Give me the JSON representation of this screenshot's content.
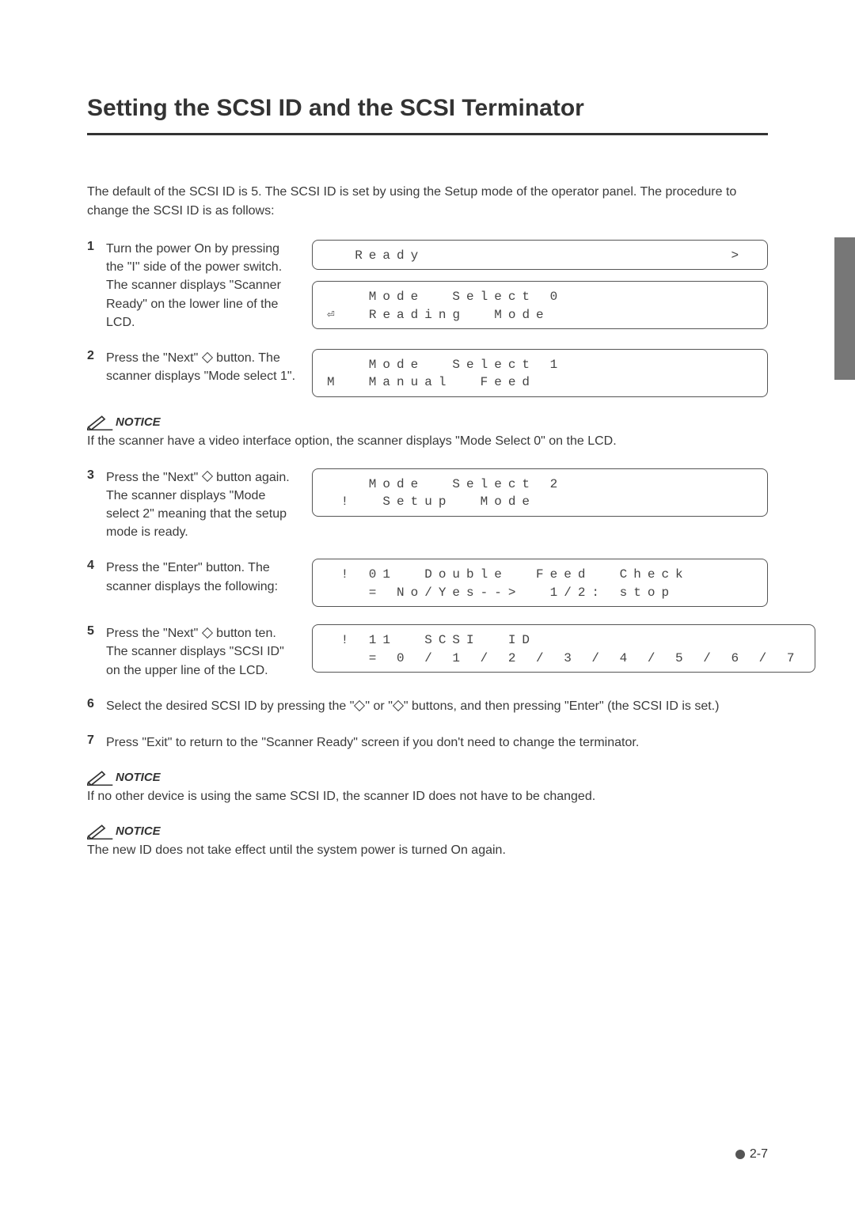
{
  "title": "Setting the SCSI ID and the SCSI Terminator",
  "intro": "The default of the SCSI ID is 5. The SCSI ID is set by using the Setup mode of the operator panel. The procedure to change the SCSI ID is as follows:",
  "steps": {
    "s1": {
      "num": "1",
      "text": "Turn the power On by pressing the \"I\" side of the power switch. The scanner displays \"Scanner Ready\" on the lower line of the LCD."
    },
    "s2": {
      "num": "2",
      "text_a": "Press the \"Next\" ",
      "text_b": " button. The scanner displays \"Mode select 1\"."
    },
    "s3": {
      "num": "3",
      "text_a": "Press the \"Next\" ",
      "text_b": " button again. The scanner displays \"Mode select 2\" meaning that the setup mode is ready."
    },
    "s4": {
      "num": "4",
      "text": "Press the \"Enter\" button. The scanner displays the following:"
    },
    "s5": {
      "num": "5",
      "text_a": "Press the \"Next\" ",
      "text_b": " button ten. The scanner displays \"SCSI ID\" on the upper line of the LCD."
    },
    "s6": {
      "num": "6",
      "text_a": "Select the desired SCSI ID by pressing the \"",
      "text_b": "\" or \"",
      "text_c": "\" buttons, and then pressing \"Enter\" (the SCSI ID is set.)"
    },
    "s7": {
      "num": "7",
      "text": "Press \"Exit\" to return to the \"Scanner Ready\" screen if you don't need to change the terminator."
    }
  },
  "lcds": {
    "ready": "  Ready                      >",
    "mode0_l1": "   Mode  Select 0",
    "mode0_l2": "⏎  Reading  Mode",
    "mode1_l1": "   Mode  Select 1",
    "mode1_l2": "M  Manual  Feed",
    "mode2_l1": "   Mode  Select 2",
    "mode2_l2": " !  Setup  Mode",
    "dbl_l1": " ! 01  Double  Feed  Check",
    "dbl_l2": "   = No/Yes-->  1/2: stop",
    "scsi_l1": " ! 11  SCSI  ID",
    "scsi_l2": "   = 0 / 1 / 2 / 3 / 4 / 5 / 6 / 7"
  },
  "notices": {
    "label": "NOTICE",
    "n1": "If the scanner have a video interface option, the scanner displays \"Mode Select 0\" on the LCD.",
    "n2": "If no other device is using the same SCSI ID, the scanner ID does not have to be changed.",
    "n3": "The new ID does not take effect until the system power is turned On again."
  },
  "footer": "2-7"
}
